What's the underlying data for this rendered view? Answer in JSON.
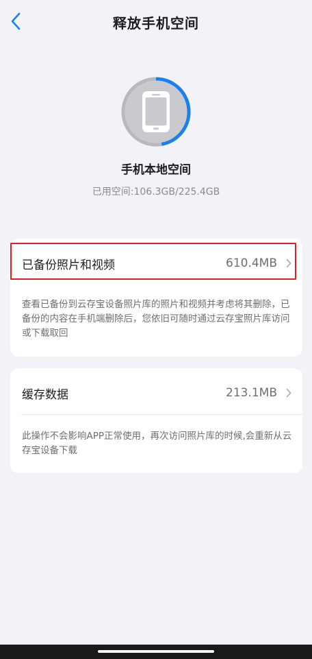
{
  "header": {
    "title": "释放手机空间"
  },
  "storage": {
    "title": "手机本地空间",
    "usage_text": "已用空间:106.3GB/225.4GB",
    "used_fraction": 0.4716,
    "used_color": "#1a7ff0",
    "free_color": "#b9b9bd"
  },
  "backup_card": {
    "label": "已备份照片和视频",
    "value": "610.4MB",
    "description": "查看已备份到云存宝设备照片库的照片和视频并考虑将其删除，已备份的内容在手机端删除后，您依旧可随时通过云存宝照片库访问或下载取回"
  },
  "cache_card": {
    "label": "缓存数据",
    "value": "213.1MB",
    "description": "此操作不会影响APP正常使用，再次访问照片库的时候,会重新从云存宝设备下载"
  },
  "colors": {
    "accent": "#1a7ff0",
    "highlight_border": "#e02020",
    "background": "#f2f3f7"
  },
  "icons": {
    "back": "chevron-left-icon",
    "phone": "phone-icon",
    "chevron": "chevron-right-icon"
  }
}
